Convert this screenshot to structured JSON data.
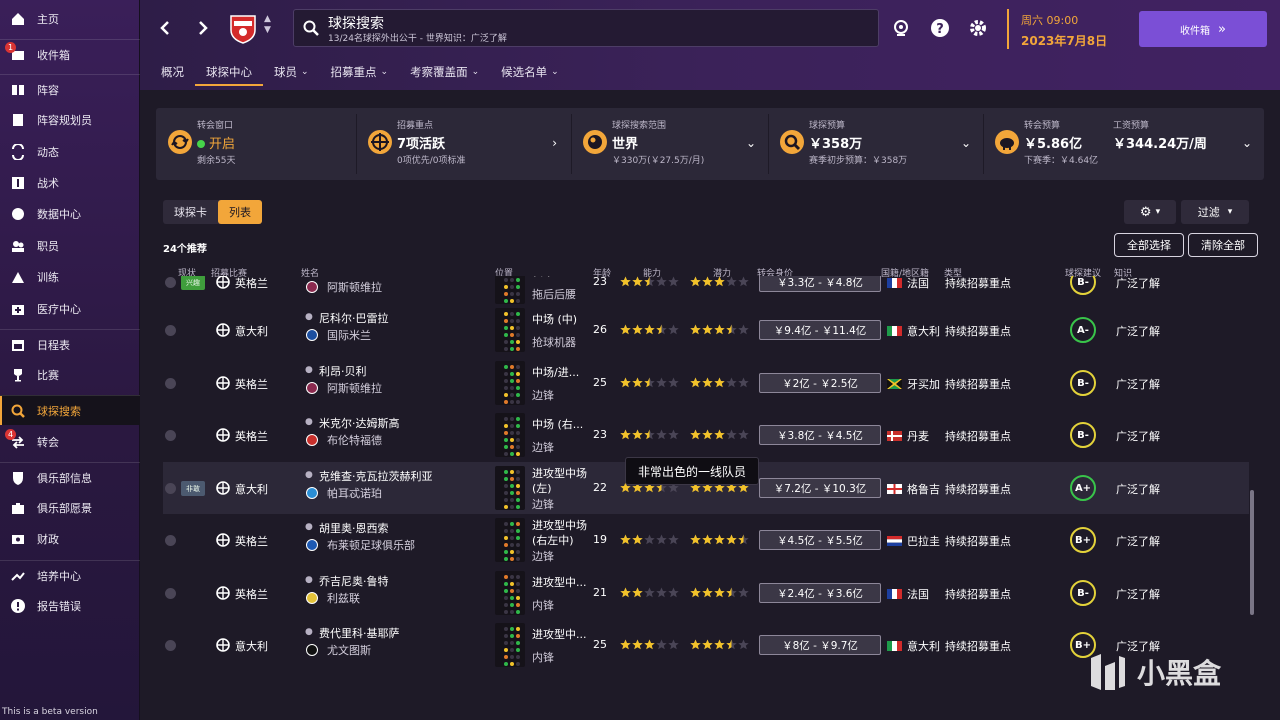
{
  "sidebar": {
    "items": [
      {
        "label": "主页",
        "icon": "home-icon"
      },
      {
        "label": "收件箱",
        "icon": "inbox-icon",
        "badge": "1"
      },
      {
        "label": "阵容",
        "icon": "squad-icon"
      },
      {
        "label": "阵容规划员",
        "icon": "clipboard-icon"
      },
      {
        "label": "动态",
        "icon": "dynamics-icon"
      },
      {
        "label": "战术",
        "icon": "tactics-icon"
      },
      {
        "label": "数据中心",
        "icon": "data-hub-icon"
      },
      {
        "label": "职员",
        "icon": "staff-icon"
      },
      {
        "label": "训练",
        "icon": "training-icon"
      },
      {
        "label": "医疗中心",
        "icon": "medical-icon"
      },
      {
        "label": "日程表",
        "icon": "calendar-icon"
      },
      {
        "label": "比赛",
        "icon": "trophy-icon"
      },
      {
        "label": "球探搜索",
        "icon": "search-icon",
        "active": true
      },
      {
        "label": "转会",
        "icon": "transfers-icon",
        "badge": "4"
      },
      {
        "label": "俱乐部信息",
        "icon": "shield-icon"
      },
      {
        "label": "俱乐部愿景",
        "icon": "briefcase-icon"
      },
      {
        "label": "财政",
        "icon": "finance-icon"
      },
      {
        "label": "培养中心",
        "icon": "development-icon"
      },
      {
        "label": "报告错误",
        "icon": "alert-icon"
      }
    ],
    "beta_text": "This is a beta version"
  },
  "header": {
    "search_title": "球探搜索",
    "search_sub": "13/24名球探外出公干 - 世界知识：广泛了解",
    "date_line1": "周六 09:00",
    "date_line2": "2023年7月8日",
    "inbox_button": "收件箱",
    "tabs": [
      {
        "label": "概况",
        "chev": false
      },
      {
        "label": "球探中心",
        "chev": false,
        "active": true
      },
      {
        "label": "球员",
        "chev": true
      },
      {
        "label": "招募重点",
        "chev": true
      },
      {
        "label": "考察覆盖面",
        "chev": true
      },
      {
        "label": "候选名单",
        "chev": true
      }
    ]
  },
  "stats": [
    {
      "label": "转会窗口",
      "value": "开启",
      "sub": "剩余55天"
    },
    {
      "label": "招募重点",
      "value": "7项活跃",
      "sub": "0项优先/0项标准"
    },
    {
      "label": "球探搜索范围",
      "value": "世界",
      "sub": "￥330万(￥27.5万/月)"
    },
    {
      "label": "球探预算",
      "value": "￥358万",
      "sub": "赛季初步预算：￥358万"
    },
    {
      "label": "转会预算",
      "value": "￥5.86亿",
      "sub": "下赛季：￥4.64亿"
    },
    {
      "label": "工资预算",
      "value": "￥344.24万/周",
      "sub": ""
    }
  ],
  "view_toggle": [
    "球探卡",
    "列表"
  ],
  "filter_label": "过滤",
  "count_label": "24个推荐",
  "select_all": "全部选择",
  "clear_all": "清除全部",
  "columns": [
    "现状",
    "招募比赛",
    "姓名",
    "位置",
    "年龄",
    "能力",
    "潜力",
    "转会身价",
    "国籍/地区籍",
    "类型",
    "球探建议",
    "知识"
  ],
  "rows": [
    {
      "status": "兴趣",
      "status_color": "#3f9e3c",
      "league": "英格兰",
      "name": "",
      "club": "阿斯顿维拉",
      "club_color": "#8b2a4f",
      "pos": "(中)",
      "role": "拖后后腰",
      "age": "23",
      "ability": 2.5,
      "potential": 3,
      "fee": "￥3.3亿 - ￥4.8亿",
      "flag": "fr",
      "nation": "法国",
      "type": "持续招募重点",
      "grade": "B-",
      "grade_color": "#e3d23a",
      "knowledge": "广泛了解"
    },
    {
      "status": "",
      "league": "意大利",
      "name": "尼科尔·巴雷拉",
      "club": "国际米兰",
      "club_color": "#1c4fa0",
      "pos": "中场 (中)",
      "role": "抢球机器",
      "age": "26",
      "ability": 3.5,
      "potential": 3.5,
      "fee": "￥9.4亿 - ￥11.4亿",
      "flag": "it",
      "nation": "意大利",
      "type": "持续招募重点",
      "grade": "A-",
      "grade_color": "#39c44a",
      "knowledge": "广泛了解"
    },
    {
      "status": "",
      "league": "英格兰",
      "name": "利昂·贝利",
      "club": "阿斯顿维拉",
      "club_color": "#8b2a4f",
      "pos": "中场/进...",
      "role": "边锋",
      "age": "25",
      "ability": 2.5,
      "potential": 3,
      "fee": "￥2亿 - ￥2.5亿",
      "flag": "jm",
      "nation": "牙买加",
      "type": "持续招募重点",
      "grade": "B-",
      "grade_color": "#e3d23a",
      "knowledge": "广泛了解"
    },
    {
      "status": "",
      "league": "英格兰",
      "name": "米克尔·达姆斯高",
      "club": "布伦特福德",
      "club_color": "#c8302c",
      "pos": "中场 (右...",
      "role": "边锋",
      "age": "23",
      "ability": 2.5,
      "potential": 3,
      "fee": "￥3.8亿 - ￥4.5亿",
      "flag": "dk",
      "nation": "丹麦",
      "type": "持续招募重点",
      "grade": "B-",
      "grade_color": "#e3d23a",
      "knowledge": "广泛了解"
    },
    {
      "status": "非敢",
      "status_color": "#4c5a70",
      "league": "意大利",
      "name": "克维查·克瓦拉茨赫利亚",
      "club": "帕耳忒诺珀",
      "club_color": "#2b8fd6",
      "pos": "进攻型中场",
      "pos2": "(左)",
      "role": "边锋",
      "age": "22",
      "ability": 3.5,
      "potential": 5,
      "fee": "￥7.2亿 - ￥10.3亿",
      "flag": "ge",
      "nation": "格鲁吉",
      "type": "持续招募重点",
      "grade": "A+",
      "grade_color": "#39c44a",
      "knowledge": "广泛了解",
      "highlight": true
    },
    {
      "status": "",
      "league": "英格兰",
      "name": "胡里奥·恩西索",
      "club": "布莱顿足球俱乐部",
      "club_color": "#1d59b3",
      "pos": "进攻型中场",
      "pos2": "(右左中)",
      "role": "边锋",
      "age": "19",
      "ability": 2,
      "potential": 4.5,
      "fee": "￥4.5亿 - ￥5.5亿",
      "flag": "py",
      "nation": "巴拉圭",
      "type": "持续招募重点",
      "grade": "B+",
      "grade_color": "#e3d23a",
      "knowledge": "广泛了解"
    },
    {
      "status": "",
      "league": "英格兰",
      "name": "乔吉尼奥·鲁特",
      "club": "利兹联",
      "club_color": "#e3c23a",
      "pos": "进攻型中...",
      "role": "内锋",
      "age": "21",
      "ability": 2,
      "potential": 3.5,
      "fee": "￥2.4亿 - ￥3.6亿",
      "flag": "fr",
      "nation": "法国",
      "type": "持续招募重点",
      "grade": "B-",
      "grade_color": "#e3d23a",
      "knowledge": "广泛了解"
    },
    {
      "status": "",
      "league": "意大利",
      "name": "费代里科·基耶萨",
      "club": "尤文图斯",
      "club_color": "#111111",
      "pos": "进攻型中...",
      "role": "内锋",
      "age": "25",
      "ability": 3,
      "potential": 3.5,
      "fee": "￥8亿 - ￥9.7亿",
      "flag": "it",
      "nation": "意大利",
      "type": "持续招募重点",
      "grade": "B+",
      "grade_color": "#e3d23a",
      "knowledge": "广泛了解"
    }
  ],
  "tooltip": "非常出色的一线队员",
  "watermark": "小黑盒",
  "colors": {
    "accent": "#f2a63a",
    "sidebar": "#3a1f59",
    "inbox_button": "#7b4fd6"
  }
}
